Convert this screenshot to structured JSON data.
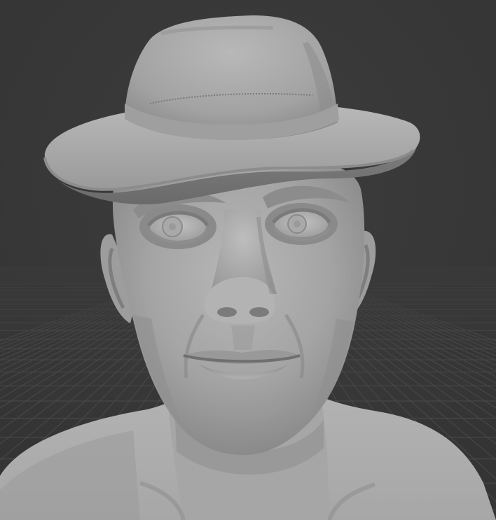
{
  "viewport": {
    "mode": "3d-viewport",
    "shading": "solid",
    "grid": true,
    "background_color": "#393939",
    "grid_color": "#4a4a4a",
    "model_color": "#a9a9a9",
    "model_shadow_color": "#6f6f6f",
    "model_highlight_color": "#c8c8c8"
  },
  "model": {
    "type": "sculpted-bust",
    "parts": [
      "hat",
      "head",
      "ears",
      "eyes",
      "nose",
      "mouth",
      "neck",
      "shoulders"
    ]
  }
}
